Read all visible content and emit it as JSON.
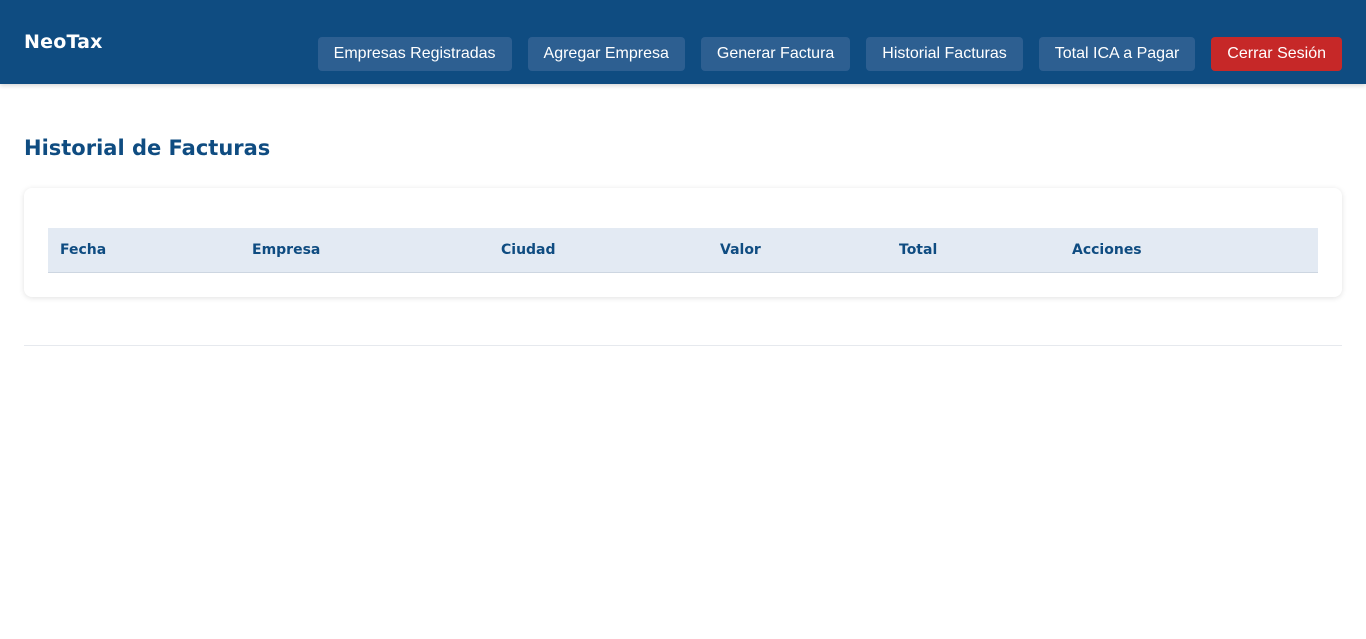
{
  "header": {
    "brand": "NeoTax",
    "nav": [
      {
        "label": "Empresas Registradas"
      },
      {
        "label": "Agregar Empresa"
      },
      {
        "label": "Generar Factura"
      },
      {
        "label": "Historial Facturas"
      },
      {
        "label": "Total ICA a Pagar"
      }
    ],
    "logout_label": "Cerrar Sesión"
  },
  "main": {
    "title": "Historial de Facturas",
    "table": {
      "columns": [
        "Fecha",
        "Empresa",
        "Ciudad",
        "Valor",
        "Total",
        "Acciones"
      ],
      "rows": []
    }
  },
  "colors": {
    "header_bg": "#0f4c81",
    "nav_button_bg": "#2d5f91",
    "logout_bg": "#c62828",
    "table_header_bg": "#e3eaf3"
  }
}
